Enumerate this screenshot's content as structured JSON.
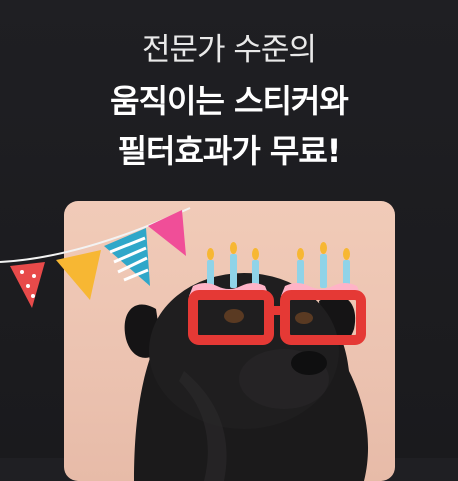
{
  "headline": {
    "line1": "전문가 수준의",
    "line2": "움직이는 스티커와",
    "line3": "필터효과가 무료!"
  },
  "colors": {
    "background": "#1c1c1f",
    "photo_background": "#efc7b4",
    "glasses_red": "#e53935",
    "cake_frosting": "#ffb3c7",
    "candle_blue": "#8fd3e8",
    "flag_pink": "#f04e98",
    "flag_teal": "#2fa7c9",
    "flag_yellow": "#f7b733",
    "flag_red": "#e84a4a"
  },
  "icons": {
    "sticker": "birthday-cake-glasses-sticker",
    "decoration": "party-bunting-flags"
  }
}
